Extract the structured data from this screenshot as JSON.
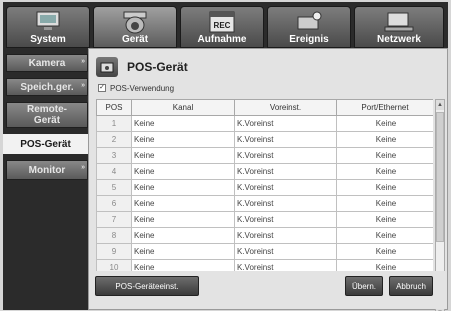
{
  "tabs": [
    {
      "label": "System",
      "icon": "monitor-icon"
    },
    {
      "label": "Gerät",
      "icon": "camera-icon"
    },
    {
      "label": "Aufnahme",
      "icon": "rec-icon"
    },
    {
      "label": "Ereignis",
      "icon": "event-icon"
    },
    {
      "label": "Netzwerk",
      "icon": "network-icon"
    }
  ],
  "active_tab": "Gerät",
  "sidebar": {
    "items": [
      {
        "label": "Kamera"
      },
      {
        "label": "Speich.ger."
      },
      {
        "label": "Remote-\nGerät"
      },
      {
        "label": "POS-Gerät"
      },
      {
        "label": "Monitor"
      }
    ],
    "active": "POS-Gerät"
  },
  "page": {
    "title": "POS-Gerät",
    "pos_usage_label": "POS-Verwendung",
    "pos_usage_checked": true
  },
  "table": {
    "headers": [
      "POS",
      "Kanal",
      "Voreinst.",
      "Port/Ethernet"
    ],
    "rows": [
      [
        "1",
        "Keine",
        "K.Voreinst",
        "Keine"
      ],
      [
        "2",
        "Keine",
        "K.Voreinst",
        "Keine"
      ],
      [
        "3",
        "Keine",
        "K.Voreinst",
        "Keine"
      ],
      [
        "4",
        "Keine",
        "K.Voreinst",
        "Keine"
      ],
      [
        "5",
        "Keine",
        "K.Voreinst",
        "Keine"
      ],
      [
        "6",
        "Keine",
        "K.Voreinst",
        "Keine"
      ],
      [
        "7",
        "Keine",
        "K.Voreinst",
        "Keine"
      ],
      [
        "8",
        "Keine",
        "K.Voreinst",
        "Keine"
      ],
      [
        "9",
        "Keine",
        "K.Voreinst",
        "Keine"
      ],
      [
        "10",
        "Keine",
        "K.Voreinst",
        "Keine"
      ]
    ]
  },
  "buttons": {
    "pos_settings": "POS-Geräteeinst.",
    "apply": "Übern.",
    "cancel": "Abbruch"
  },
  "colors": {
    "tab_bg": "#2b2b2b",
    "panel_bg": "#e3e3e3"
  }
}
